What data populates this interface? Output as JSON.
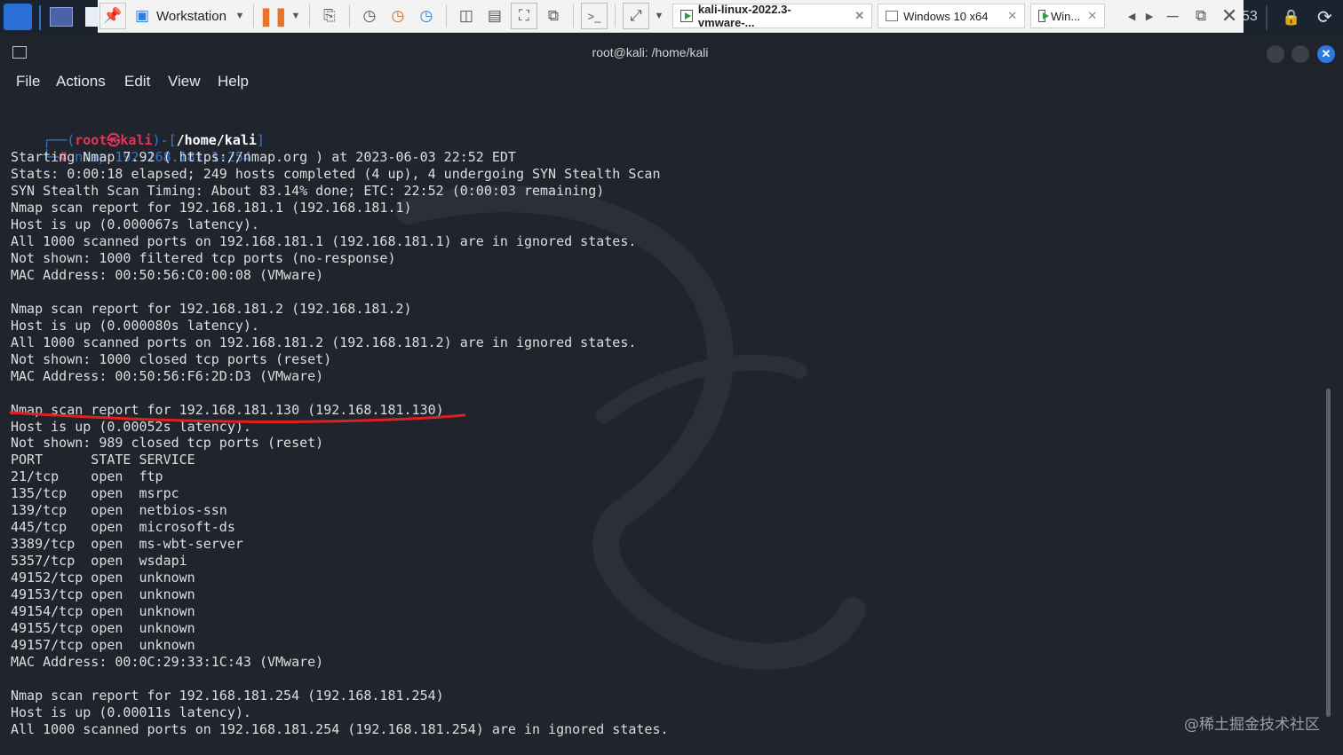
{
  "host": {
    "app_name": "Workstation",
    "tabs": [
      {
        "label": "kali-linux-2022.3-vmware-...",
        "active": true
      },
      {
        "label": "Windows 10 x64",
        "active": false
      },
      {
        "label": "Win...",
        "active": false
      }
    ],
    "partial_text": "53"
  },
  "terminal": {
    "title": "root@kali: /home/kali",
    "menu": [
      "File",
      "Actions",
      "Edit",
      "View",
      "Help"
    ],
    "prompt": {
      "user": "root",
      "host": "kali",
      "cwd": "/home/kali",
      "command": "nmap 192.168.181.1-254"
    },
    "lines": [
      "Starting Nmap 7.92 ( https://nmap.org ) at 2023-06-03 22:52 EDT",
      "Stats: 0:00:18 elapsed; 249 hosts completed (4 up), 4 undergoing SYN Stealth Scan",
      "SYN Stealth Scan Timing: About 83.14% done; ETC: 22:52 (0:00:03 remaining)",
      "Nmap scan report for 192.168.181.1 (192.168.181.1)",
      "Host is up (0.000067s latency).",
      "All 1000 scanned ports on 192.168.181.1 (192.168.181.1) are in ignored states.",
      "Not shown: 1000 filtered tcp ports (no-response)",
      "MAC Address: 00:50:56:C0:00:08 (VMware)",
      "",
      "Nmap scan report for 192.168.181.2 (192.168.181.2)",
      "Host is up (0.000080s latency).",
      "All 1000 scanned ports on 192.168.181.2 (192.168.181.2) are in ignored states.",
      "Not shown: 1000 closed tcp ports (reset)",
      "MAC Address: 00:50:56:F6:2D:D3 (VMware)",
      "",
      "Nmap scan report for 192.168.181.130 (192.168.181.130)",
      "Host is up (0.00052s latency).",
      "Not shown: 989 closed tcp ports (reset)",
      "PORT      STATE SERVICE",
      "21/tcp    open  ftp",
      "135/tcp   open  msrpc",
      "139/tcp   open  netbios-ssn",
      "445/tcp   open  microsoft-ds",
      "3389/tcp  open  ms-wbt-server",
      "5357/tcp  open  wsdapi",
      "49152/tcp open  unknown",
      "49153/tcp open  unknown",
      "49154/tcp open  unknown",
      "49155/tcp open  unknown",
      "49157/tcp open  unknown",
      "MAC Address: 00:0C:29:33:1C:43 (VMware)",
      "",
      "Nmap scan report for 192.168.181.254 (192.168.181.254)",
      "Host is up (0.00011s latency).",
      "All 1000 scanned ports on 192.168.181.254 (192.168.181.254) are in ignored states."
    ]
  },
  "watermark": "@稀土掘金技术社区",
  "colors": {
    "terminal_bg": "#20242c",
    "text": "#dedede",
    "prompt_blue": "#3b77c9",
    "root_red": "#e0365b",
    "annotation_red": "#e02020",
    "close_button": "#2f7ae0"
  }
}
